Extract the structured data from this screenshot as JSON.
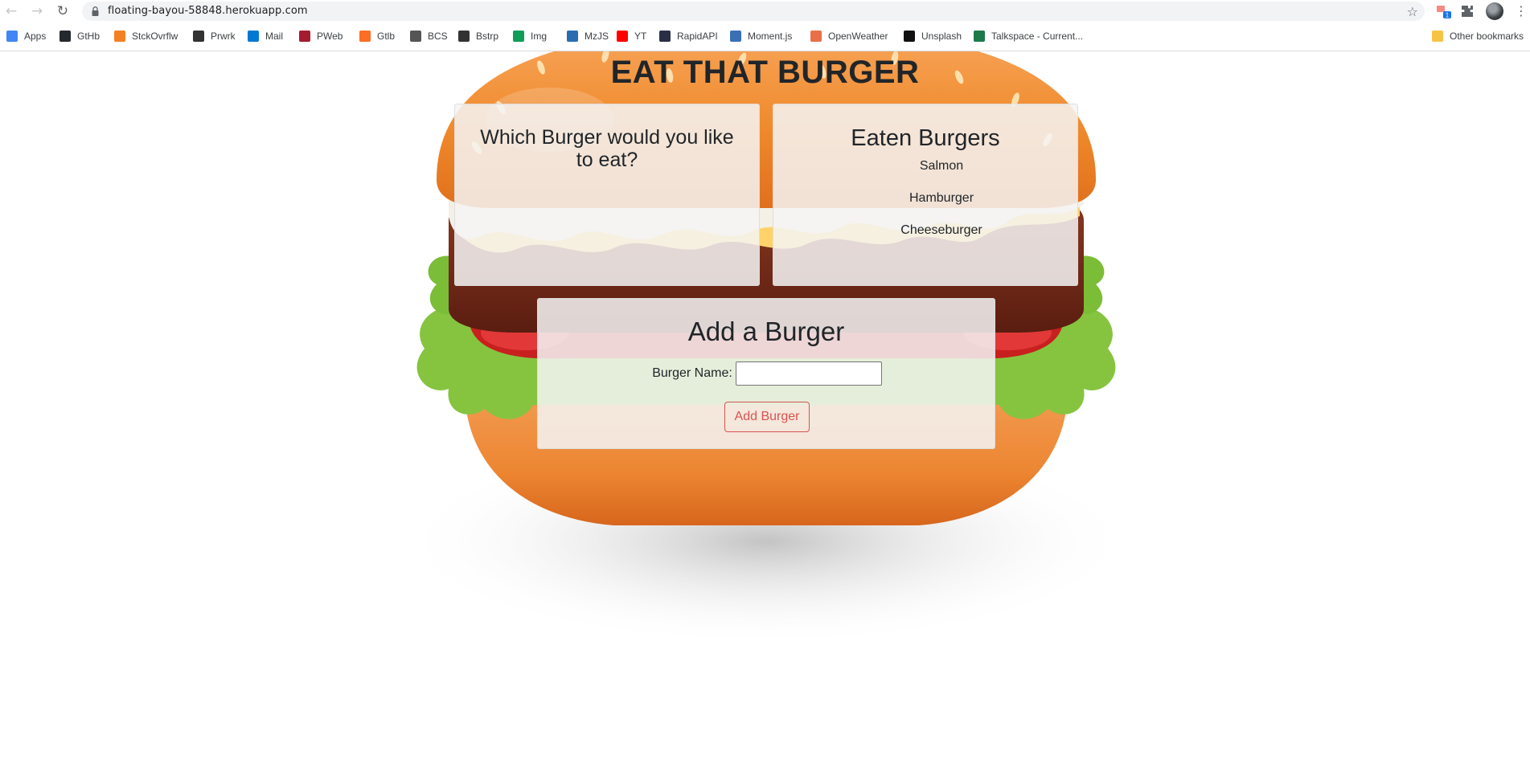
{
  "browser": {
    "url": "floating-bayou-58848.herokuapp.com",
    "ext_badge": "1",
    "bookmarks": [
      {
        "label": "Apps",
        "icon": "apps-grid-icon",
        "color": "#4285f4"
      },
      {
        "label": "GtHb",
        "icon": "github-icon",
        "color": "#24292e"
      },
      {
        "label": "StckOvrflw",
        "icon": "stackoverflow-icon",
        "color": "#f48024"
      },
      {
        "label": "Prwrk",
        "icon": "book-icon",
        "color": "#333333"
      },
      {
        "label": "Mail",
        "icon": "outlook-icon",
        "color": "#0078d4"
      },
      {
        "label": "PWeb",
        "icon": "shield-icon",
        "color": "#a51c30"
      },
      {
        "label": "Gtlb",
        "icon": "gitlab-icon",
        "color": "#fc6d26"
      },
      {
        "label": "BCS",
        "icon": "globe-icon",
        "color": "#555555"
      },
      {
        "label": "Bstrp",
        "icon": "bootstrap-icon",
        "color": "#333333"
      },
      {
        "label": "Img",
        "icon": "image-icon",
        "color": "#0f9d58"
      },
      {
        "label": "MzJS",
        "icon": "mozilla-icon",
        "color": "#2b6cb0"
      },
      {
        "label": "YT",
        "icon": "youtube-icon",
        "color": "#ff0000"
      },
      {
        "label": "RapidAPI",
        "icon": "rapidapi-icon",
        "color": "#2a2f45"
      },
      {
        "label": "Moment.js",
        "icon": "momentjs-icon",
        "color": "#3a6fb6"
      },
      {
        "label": "OpenWeather",
        "icon": "openweather-icon",
        "color": "#eb6e4b"
      },
      {
        "label": "Unsplash",
        "icon": "unsplash-icon",
        "color": "#111111"
      },
      {
        "label": "Talkspace - Current...",
        "icon": "talkspace-icon",
        "color": "#1c7a4a"
      }
    ],
    "other_bookmarks": "Other bookmarks"
  },
  "page": {
    "title": "EAT THAT BURGER",
    "to_eat": {
      "heading": "Which Burger would you like to eat?",
      "items": []
    },
    "eaten": {
      "heading": "Eaten Burgers",
      "items": [
        "Salmon",
        "Hamburger",
        "Cheeseburger"
      ]
    },
    "add_form": {
      "heading": "Add a Burger",
      "field_label": "Burger Name:",
      "field_value": "",
      "field_placeholder": "",
      "button_label": "Add Burger"
    }
  },
  "colors": {
    "button_accent": "#d9534f",
    "text": "#212529"
  }
}
